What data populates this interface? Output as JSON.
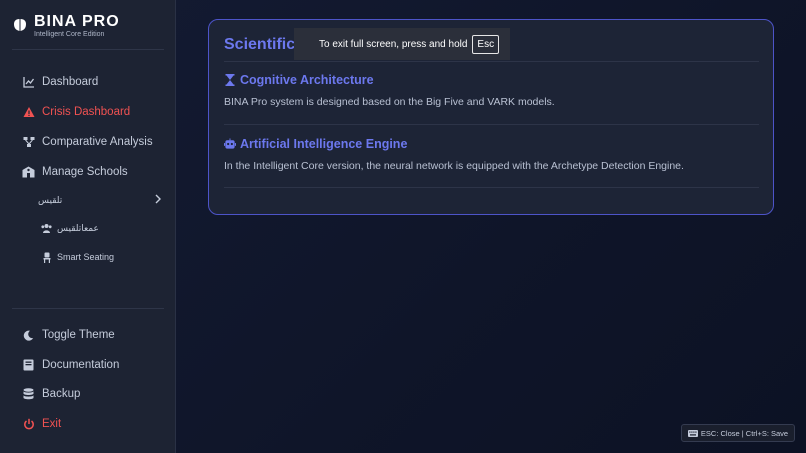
{
  "brand": {
    "title": "BINA PRO",
    "subtitle": "Intelligent Core Edition"
  },
  "sidebar": {
    "items": [
      {
        "label": "Dashboard",
        "icon": "chart-line-icon"
      },
      {
        "label": "Crisis Dashboard",
        "icon": "warning-icon"
      },
      {
        "label": "Comparative Analysis",
        "icon": "diagram-icon"
      },
      {
        "label": "Manage Schools",
        "icon": "school-icon"
      }
    ],
    "submenu": {
      "label": "تلقيس",
      "icon": "chevron-right-icon"
    },
    "subitems": [
      {
        "label": "عمعاتلقيس",
        "icon": "users-icon"
      },
      {
        "label": "Smart Seating",
        "icon": "chair-icon"
      }
    ],
    "bottom": [
      {
        "label": "Toggle Theme",
        "icon": "moon-icon"
      },
      {
        "label": "Documentation",
        "icon": "book-icon"
      },
      {
        "label": "Backup",
        "icon": "database-icon"
      },
      {
        "label": "Exit",
        "icon": "power-icon"
      }
    ]
  },
  "card": {
    "heading": "Scientific",
    "sections": [
      {
        "title": "Cognitive Architecture",
        "icon": "hourglass-icon",
        "text": "BINA Pro system is designed based on the Big Five and VARK models."
      },
      {
        "title": "Artificial Intelligence Engine",
        "icon": "robot-icon",
        "text": "In the Intelligent Core version, the neural network is equipped with the Archetype Detection Engine."
      }
    ]
  },
  "toast": {
    "message": "To exit full screen, press and hold",
    "key": "Esc"
  },
  "hint": {
    "text": "ESC: Close | Ctrl+S: Save",
    "icon": "keyboard-icon"
  },
  "colors": {
    "accent": "#6c78ee",
    "danger": "#f05252",
    "sidebar_bg": "#1d2333",
    "card_border": "#4d54c9"
  }
}
